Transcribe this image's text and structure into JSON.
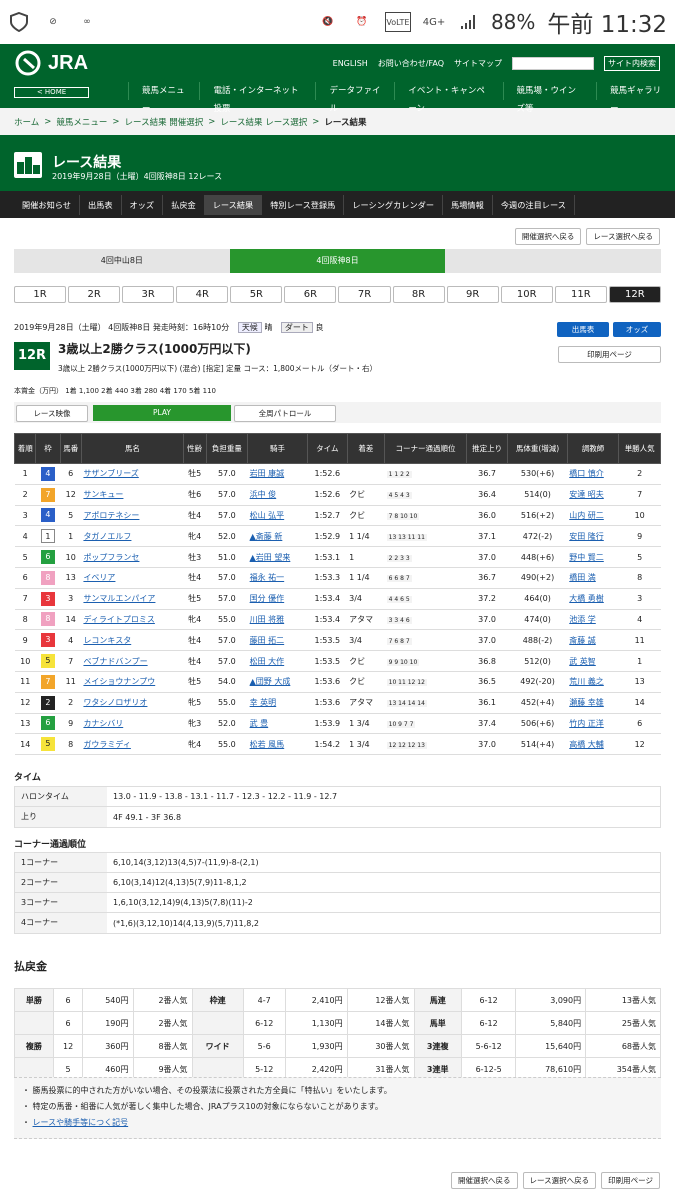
{
  "status": {
    "pct": "88%",
    "time": "午前 11:32",
    "icon_names": [
      "shield-icon",
      "wifi-off-icon",
      "voicemail-icon",
      "mute-icon",
      "alarm-icon",
      "volte-icon",
      "4g-icon",
      "signal-icon"
    ]
  },
  "header": {
    "logo": "JRA",
    "home": "< HOME",
    "links": [
      "ENGLISH",
      "お問い合わせ/FAQ",
      "サイトマップ"
    ],
    "search_btn": "サイト内検索",
    "nav": [
      "競馬メニュー",
      "電話・インターネット投票",
      "データファイル",
      "イベント・キャンペーン",
      "競馬場・ウインズ等",
      "競馬ギャラリー"
    ]
  },
  "breadcrumb": [
    "ホーム",
    "競馬メニュー",
    "レース結果 開催選択",
    "レース結果 レース選択",
    "レース結果"
  ],
  "title": {
    "h": "レース結果",
    "s": "2019年9月28日（土曜）4回阪神8日 12レース"
  },
  "subnav": [
    "開催お知らせ",
    "出馬表",
    "オッズ",
    "払戻金",
    "レース結果",
    "特別レース登録馬",
    "レーシングカレンダー",
    "馬場情報",
    "今週の注目レース"
  ],
  "btns": {
    "back_meet": "開催選択へ戻る",
    "back_race": "レース選択へ戻る",
    "print": "印刷用ページ"
  },
  "tabs": [
    "4回中山8日",
    "4回阪神8日"
  ],
  "races": [
    "1R",
    "2R",
    "3R",
    "4R",
    "5R",
    "6R",
    "7R",
    "8R",
    "9R",
    "10R",
    "11R",
    "12R"
  ],
  "race": {
    "info": "2019年9月28日（土曜） 4回阪神8日 発走時刻：16時10分",
    "weather_l": "天候",
    "weather": "晴",
    "track_l": "ダート",
    "track": "良",
    "num": "12R",
    "name": "3歳以上2勝クラス(1000万円以下)",
    "sub": "3歳以上 2勝クラス(1000万円以下) (混合) [指定] 定量 コース：1,800メートル（ダート・右）",
    "prize": "本賞金（万円） 1着 1,100 2着 440 3着 280 4着 170 5着 110",
    "shutuba": "出馬表",
    "odds": "オッズ",
    "video": "レース映像",
    "play": "PLAY",
    "patrol": "全周パトロール"
  },
  "table": {
    "headers": [
      "着順",
      "枠",
      "馬番",
      "馬名",
      "性齢",
      "負担重量",
      "騎手",
      "タイム",
      "着差",
      "コーナー通過順位",
      "推定上り",
      "馬体重(増減)",
      "調教師",
      "単勝人気"
    ],
    "rows": [
      [
        "1",
        "4",
        "6",
        "サザンブリーズ",
        "牡5",
        "57.0",
        "岩田 康誠",
        "1:52.6",
        "",
        "1 1 2 2",
        "36.7",
        "530(+6)",
        "橋口 慎介",
        "2"
      ],
      [
        "2",
        "7",
        "12",
        "サンキュー",
        "牡6",
        "57.0",
        "浜中 俊",
        "1:52.6",
        "クビ",
        "4 5 4 3",
        "36.4",
        "514(0)",
        "安達 昭夫",
        "7"
      ],
      [
        "3",
        "4",
        "5",
        "アポロテネシー",
        "牡4",
        "57.0",
        "松山 弘平",
        "1:52.7",
        "クビ",
        "7 8 10 10",
        "36.0",
        "516(+2)",
        "山内 研二",
        "10"
      ],
      [
        "4",
        "1",
        "1",
        "タガノエルフ",
        "牝4",
        "52.0",
        "▲斎藤 新",
        "1:52.9",
        "1 1/4",
        "13 13 11 11",
        "37.1",
        "472(-2)",
        "安田 隆行",
        "9"
      ],
      [
        "5",
        "6",
        "10",
        "ポップフランセ",
        "牡3",
        "51.0",
        "▲岩田 望来",
        "1:53.1",
        "1",
        "2 2 3 3",
        "37.0",
        "448(+6)",
        "野中 賢二",
        "5"
      ],
      [
        "6",
        "8",
        "13",
        "イベリア",
        "牡4",
        "57.0",
        "福永 祐一",
        "1:53.3",
        "1 1/4",
        "6 6 8 7",
        "36.7",
        "490(+2)",
        "橋田 満",
        "8"
      ],
      [
        "7",
        "3",
        "3",
        "サンマルエンパイア",
        "牡5",
        "57.0",
        "国分 優作",
        "1:53.4",
        "3/4",
        "4 4 6 5",
        "37.2",
        "464(0)",
        "大橋 勇樹",
        "3"
      ],
      [
        "8",
        "8",
        "14",
        "ディライトプロミス",
        "牝4",
        "55.0",
        "川田 将雅",
        "1:53.4",
        "アタマ",
        "3 3 4 6",
        "37.0",
        "474(0)",
        "池添 学",
        "4"
      ],
      [
        "9",
        "3",
        "4",
        "レコンキスタ",
        "牡4",
        "57.0",
        "藤田 拓二",
        "1:53.5",
        "3/4",
        "7 6 8 7",
        "37.0",
        "488(-2)",
        "斎藤 誠",
        "11"
      ],
      [
        "10",
        "5",
        "7",
        "ベブナドバンプー",
        "牡4",
        "57.0",
        "松田 大作",
        "1:53.5",
        "クビ",
        "9 9 10 10",
        "36.8",
        "512(0)",
        "武 英智",
        "1"
      ],
      [
        "11",
        "7",
        "11",
        "メイショウナンプウ",
        "牡5",
        "54.0",
        "▲団野 大成",
        "1:53.6",
        "クビ",
        "10 11 12 12",
        "36.5",
        "492(-20)",
        "荒川 義之",
        "13"
      ],
      [
        "12",
        "2",
        "2",
        "ワタシノロザリオ",
        "牝5",
        "55.0",
        "幸 英明",
        "1:53.6",
        "アタマ",
        "13 14 14 14",
        "36.1",
        "452(+4)",
        "瀬藤 幸雄",
        "14"
      ],
      [
        "13",
        "6",
        "9",
        "カナシバリ",
        "牝3",
        "52.0",
        "武 豊",
        "1:53.9",
        "1 3/4",
        "10 9 7 7",
        "37.4",
        "506(+6)",
        "竹内 正洋",
        "6"
      ],
      [
        "14",
        "5",
        "8",
        "ガウラミディ",
        "牝4",
        "55.0",
        "松若 風馬",
        "1:54.2",
        "1 3/4",
        "12 12 12 13",
        "37.0",
        "514(+4)",
        "高橋 大輔",
        "12"
      ]
    ]
  },
  "time": {
    "title": "タイム",
    "halon_l": "ハロンタイム",
    "halon": "13.0 - 11.9 - 13.8 - 13.1 - 11.7 - 12.3 - 12.2 - 11.9 - 12.7",
    "agari_l": "上り",
    "agari": "4F 49.1 - 3F 36.8"
  },
  "corner": {
    "title": "コーナー通過順位",
    "rows": [
      [
        "1コーナー",
        "6,10,14(3,12)13(4,5)7-(11,9)-8-(2,1)"
      ],
      [
        "2コーナー",
        "6,10(3,14)12(4,13)5(7,9)11-8,1,2"
      ],
      [
        "3コーナー",
        "1,6,10(3,12,14)9(4,13)5(7,8)(11)-2"
      ],
      [
        "4コーナー",
        "(*1,6)(3,12,10)14(4,13,9)(5,7)11,8,2"
      ]
    ]
  },
  "payout": {
    "title": "払戻金",
    "rows": [
      [
        "単勝",
        "6",
        "540円",
        "2番人気",
        "枠連",
        "4-7",
        "2,410円",
        "12番人気",
        "馬連",
        "6-12",
        "3,090円",
        "13番人気"
      ],
      [
        "",
        "6",
        "190円",
        "2番人気",
        "",
        "6-12",
        "1,130円",
        "14番人気",
        "馬単",
        "6-12",
        "5,840円",
        "25番人気"
      ],
      [
        "複勝",
        "12",
        "360円",
        "8番人気",
        "ワイド",
        "5-6",
        "1,930円",
        "30番人気",
        "3連複",
        "5-6-12",
        "15,640円",
        "68番人気"
      ],
      [
        "",
        "5",
        "460円",
        "9番人気",
        "",
        "5-12",
        "2,420円",
        "31番人気",
        "3連単",
        "6-12-5",
        "78,610円",
        "354番人気"
      ]
    ]
  },
  "notes": [
    "勝馬投票に的中された方がいない場合、その投票法に投票された方全員に「特払い」をいたします。",
    "特定の馬番・組番に人気が著しく集中した場合、JRAプラス10の対象にならないことがあります。",
    "レースや騎手等につく記号"
  ],
  "colors": {
    "green": "#00642c",
    "waku": [
      "#ffffff",
      "#222222",
      "#e8363c",
      "#2a5fc8",
      "#f6e33a",
      "#24a040",
      "#f2a52a",
      "#f0a1c0"
    ]
  }
}
